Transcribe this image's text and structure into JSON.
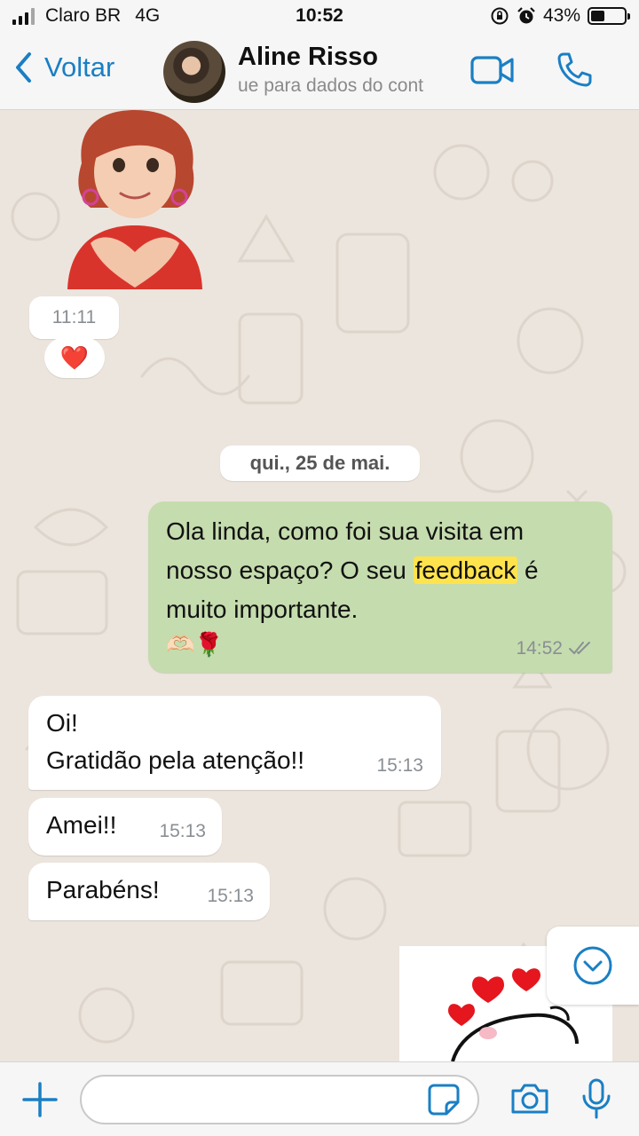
{
  "status_bar": {
    "carrier": "Claro BR",
    "network": "4G",
    "time": "10:52",
    "battery_percent": "43%",
    "battery_level": 0.43
  },
  "header": {
    "back_label": "Voltar",
    "contact_name": "Aline Risso",
    "contact_subtitle": "ue para dados do cont",
    "accent_color": "#1a7fc4"
  },
  "messages": {
    "sticker_time": "11:11",
    "reaction": "❤️",
    "date_separator": "qui., 25 de mai.",
    "outgoing": {
      "text_before": "Ola linda, como foi sua visita em nosso espaço? O seu ",
      "highlight": "feedback",
      "text_after": " é muito importante.",
      "emoji": "🫶🏻🌹",
      "time": "14:52",
      "bubble_color": "#c5dcae"
    },
    "incoming": [
      {
        "line1": "Oi!",
        "line2": "Gratidão pela atenção!!",
        "time": "15:13"
      },
      {
        "text": "Amei!!",
        "time": "15:13"
      },
      {
        "text": "Parabéns!",
        "time": "15:13"
      }
    ]
  },
  "input_bar": {
    "message_placeholder": ""
  },
  "icons": [
    "chevron-left-icon",
    "video-call-icon",
    "phone-icon",
    "scroll-down-icon",
    "plus-icon",
    "sticker-icon",
    "camera-icon",
    "microphone-icon"
  ]
}
